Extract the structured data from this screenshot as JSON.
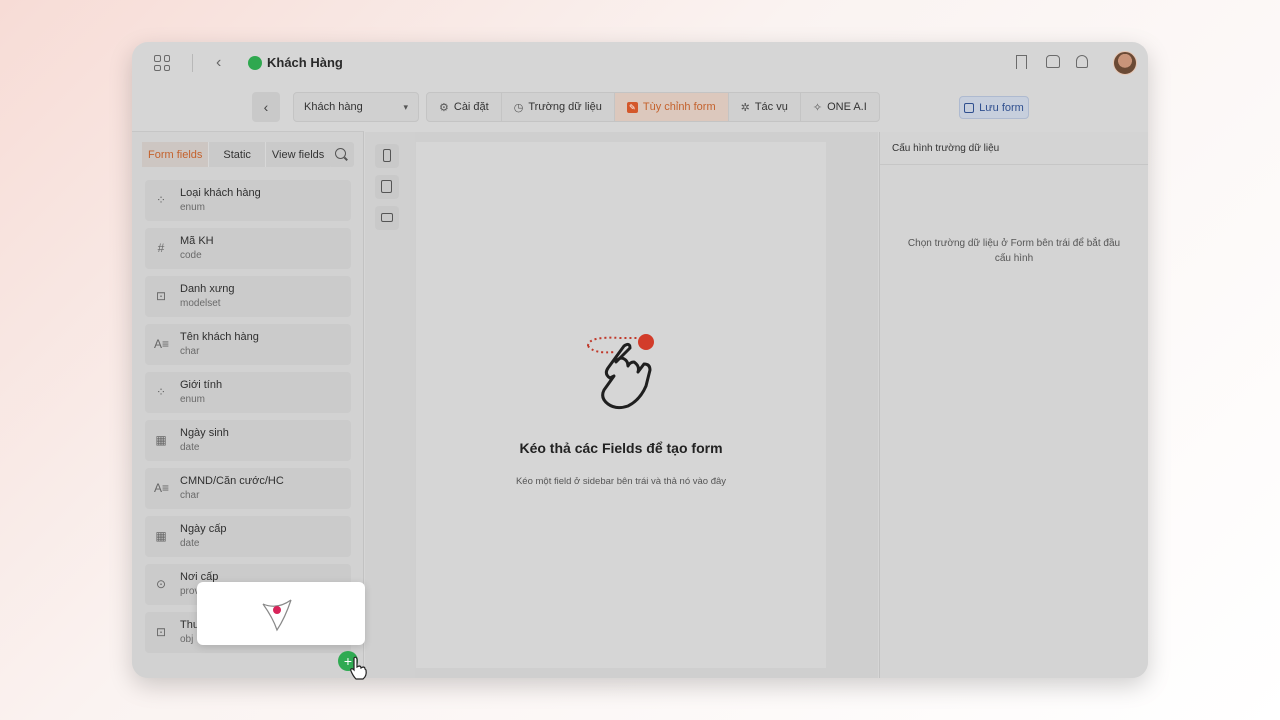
{
  "app": {
    "title": "Khách Hàng"
  },
  "toolbar": {
    "model_select": "Khách hàng",
    "tabs": [
      {
        "label": "Cài đặt",
        "icon": "sliders-icon"
      },
      {
        "label": "Trường dữ liệu",
        "icon": "clock-check-icon"
      },
      {
        "label": "Tùy chỉnh form",
        "icon": "edit-icon"
      },
      {
        "label": "Tác vụ",
        "icon": "bug-icon"
      },
      {
        "label": "ONE A.I",
        "icon": "sparkle-icon"
      }
    ],
    "active_tab": "Tùy chỉnh form",
    "save_label": "Lưu form"
  },
  "left_panel": {
    "tabs": [
      "Form fields",
      "Static",
      "View fields"
    ],
    "fields": [
      {
        "name": "Loại khách hàng",
        "type": "enum",
        "icon": "shapes-icon"
      },
      {
        "name": "Mã KH",
        "type": "code",
        "icon": "hash-icon"
      },
      {
        "name": "Danh xưng",
        "type": "modelset",
        "icon": "search-doc-icon"
      },
      {
        "name": "Tên khách hàng",
        "type": "char",
        "icon": "text-icon"
      },
      {
        "name": "Giới tính",
        "type": "enum",
        "icon": "shapes-icon"
      },
      {
        "name": "Ngày sinh",
        "type": "date",
        "icon": "calendar-icon"
      },
      {
        "name": "CMND/Căn cước/HC",
        "type": "char",
        "icon": "text-icon"
      },
      {
        "name": "Ngày cấp",
        "type": "date",
        "icon": "calendar-icon"
      },
      {
        "name": "Nơi cấp",
        "type": "prov",
        "icon": "pin-icon"
      },
      {
        "name": "Thu",
        "type": "obj",
        "icon": "search-doc-icon"
      }
    ]
  },
  "canvas": {
    "title": "Kéo thả các Fields để tạo form",
    "subtitle": "Kéo một field ở sidebar bên trái và thả nó vào đây"
  },
  "right_panel": {
    "title": "Cấu hình trường dữ liệu",
    "hint": "Chọn trường dữ liệu ở Form bên trái để bắt đầu cấu hình"
  },
  "colors": {
    "accent": "#d4572a",
    "primary": "#2f4f8f",
    "green": "#2faa52"
  }
}
